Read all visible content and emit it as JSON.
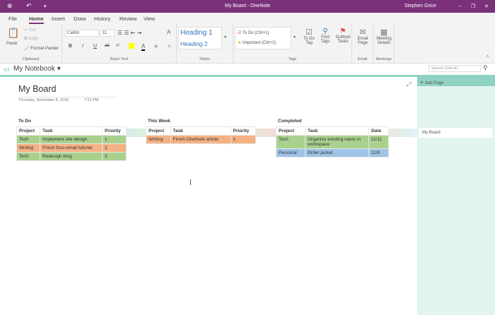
{
  "window": {
    "title": "My Board - OneNote",
    "user": "Stephen Grice",
    "minimize": "–",
    "restore": "❐",
    "close": "✕",
    "back": "⊕",
    "undo": "↶",
    "qat": "▾"
  },
  "tabs": [
    "File",
    "Home",
    "Insert",
    "Draw",
    "History",
    "Review",
    "View"
  ],
  "ribbon": {
    "clipboard": {
      "paste": "Paste",
      "cut": "Cut",
      "copy": "Copy",
      "format_painter": "Format Painter",
      "label": "Clipboard"
    },
    "basic_text": {
      "font": "Calibri",
      "size": "11",
      "label": "Basic Text",
      "bold": "B",
      "italic": "I",
      "underline": "U",
      "strike": "ab",
      "sup": "x²",
      "fontcolor": "A",
      "clear": "✕",
      "style_a": "A"
    },
    "styles": {
      "h1": "Heading 1",
      "h2": "Heading 2",
      "label": "Styles"
    },
    "tags": {
      "todo": "To Do (Ctrl+1)",
      "important": "Important (Ctrl+2)",
      "todo_tag": "To Do Tag",
      "find_tags": "Find Tags",
      "outlook_tasks": "Outlook Tasks",
      "label": "Tags"
    },
    "email": {
      "email_page": "Email Page",
      "label": "Email"
    },
    "meetings": {
      "meeting_details": "Meeting Details",
      "label": "Meetings"
    }
  },
  "notebook": {
    "name": "My Notebook"
  },
  "search": {
    "placeholder": "Search (Ctrl+E)"
  },
  "page": {
    "title": "My Board",
    "date": "Thursday, November 8, 2018",
    "time": "7:21 PM"
  },
  "sidebar": {
    "add_page": "Add Page",
    "pages": [
      "My Board"
    ]
  },
  "colors": {
    "accent": "#7b317a",
    "green": "#a9d18e",
    "orange": "#f4b183",
    "blue": "#9dc3e6",
    "teal": "#8fd2c3"
  },
  "boards": [
    {
      "title": "To Do",
      "headers": [
        "Project",
        "Task",
        "Priority"
      ],
      "rows": [
        [
          "Tech",
          "Implement site design",
          "1"
        ],
        [
          "Writing",
          "Finish foss-email tutorial",
          "2"
        ],
        [
          "Tech",
          "Redesign blog",
          "3"
        ]
      ]
    },
    {
      "title": "This Week",
      "headers": [
        "Project",
        "Task",
        "Priority"
      ],
      "rows": [
        [
          "Writing",
          "Finish OneNote article",
          "1"
        ]
      ]
    },
    {
      "title": "Completed",
      "headers": [
        "Project",
        "Task",
        "Date"
      ],
      "rows": [
        [
          "Tech",
          "Organize existing repos in workspace",
          "11/11"
        ],
        [
          "Personal",
          "Order jacket",
          "11/9"
        ]
      ]
    }
  ]
}
